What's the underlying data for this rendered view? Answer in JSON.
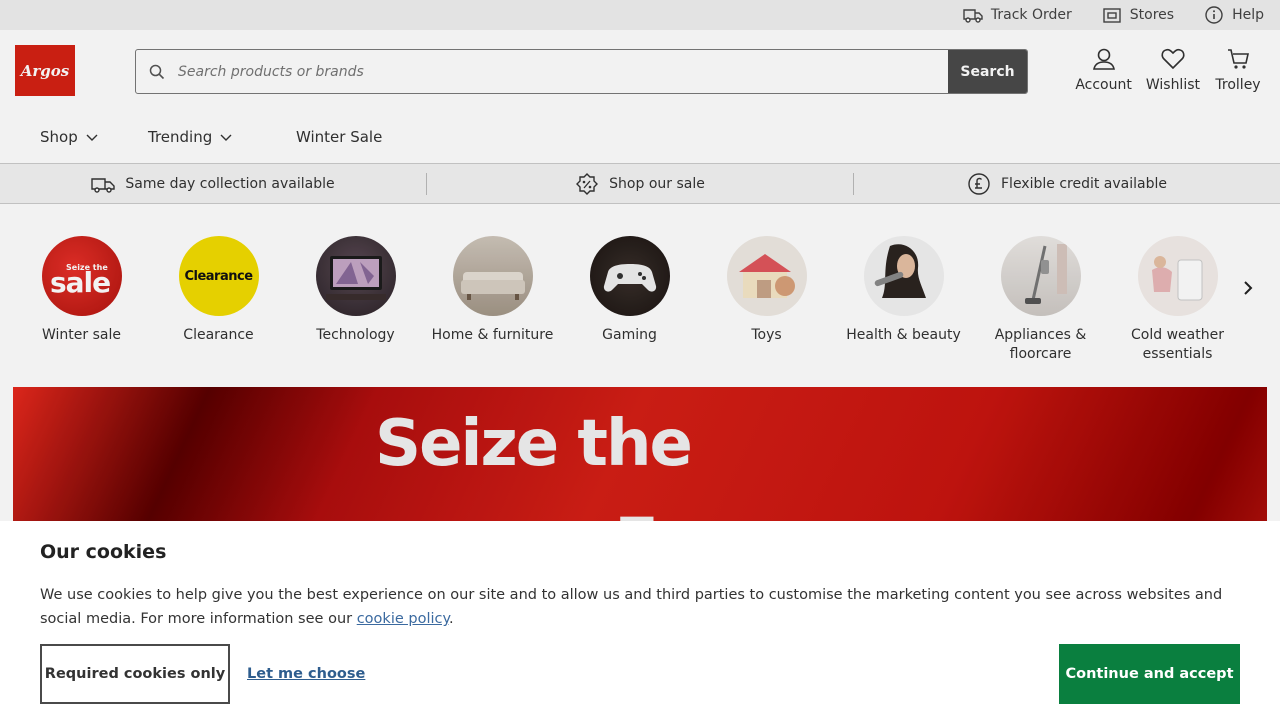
{
  "utility": {
    "track_order": "Track Order",
    "stores": "Stores",
    "help": "Help"
  },
  "header": {
    "logo_text": "Argos",
    "search_placeholder": "Search products or brands",
    "search_button": "Search",
    "account": "Account",
    "wishlist": "Wishlist",
    "trolley": "Trolley"
  },
  "nav": {
    "shop": "Shop",
    "trending": "Trending",
    "winter_sale": "Winter Sale"
  },
  "usp": {
    "collection": "Same day collection available",
    "sale": "Shop our sale",
    "credit": "Flexible credit available"
  },
  "categories": [
    {
      "label": "Winter sale",
      "image_text": "Seize the sale",
      "icon": "winter-sale-image"
    },
    {
      "label": "Clearance",
      "image_text": "Clearance",
      "icon": "clearance-image"
    },
    {
      "label": "Technology",
      "icon": "technology-image"
    },
    {
      "label": "Home & furniture",
      "icon": "home-furniture-image"
    },
    {
      "label": "Gaming",
      "icon": "gaming-image"
    },
    {
      "label": "Toys",
      "icon": "toys-image"
    },
    {
      "label": "Health & beauty",
      "icon": "health-beauty-image"
    },
    {
      "label": "Appliances & floorcare",
      "icon": "appliances-image"
    },
    {
      "label": "Cold weather essentials",
      "icon": "cold-weather-image"
    }
  ],
  "hero": {
    "title": "Seize the",
    "big_text": "sale"
  },
  "cookie": {
    "title": "Our cookies",
    "text": "We use cookies to help give you the best experience on our site and to allow us and third parties to customise the marketing content you see across websites and social media. For more information see our",
    "link": "cookie policy",
    "text_end": ".",
    "required_button": "Required cookies only",
    "choose_link": "Let me choose",
    "accept_button": "Continue and accept"
  },
  "colors": {
    "brand_red": "#d42114",
    "accept_green": "#0a7f3f",
    "search_button": "#4a4a4a"
  }
}
